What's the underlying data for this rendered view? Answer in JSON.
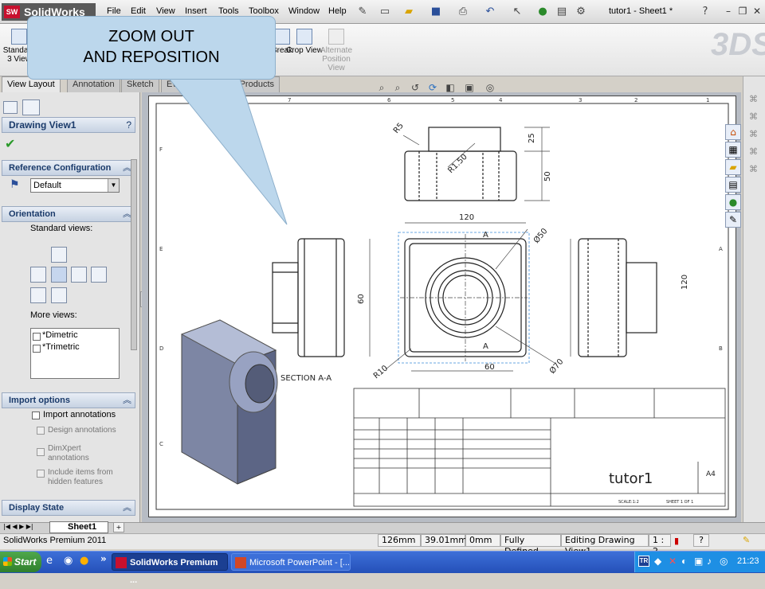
{
  "app": {
    "logo_text": "SolidWorks",
    "doc_title": "tutor1 - Sheet1 *"
  },
  "menu": [
    "File",
    "Edit",
    "View",
    "Insert",
    "Tools",
    "Toolbox",
    "Window",
    "Help"
  ],
  "command_bar": {
    "standard_views_label": "Standard 3 View",
    "break_label": "Break",
    "crop_view_label": "Crop View",
    "alternate_position_label": "Alternate Position View"
  },
  "tabs": [
    "View Layout",
    "Annotation",
    "Sketch",
    "Evaluate",
    "Office Products"
  ],
  "callout": {
    "line1": "ZOOM OUT",
    "line2": "AND REPOSITION"
  },
  "property_manager": {
    "title": "Drawing View1",
    "help": "?",
    "reference_configuration": {
      "title": "Reference Configuration",
      "value": "Default"
    },
    "orientation": {
      "title": "Orientation",
      "standard_views_label": "Standard views:",
      "more_views_label": "More views:",
      "more_views": [
        "*Dimetric",
        "*Trimetric"
      ]
    },
    "import_options": {
      "title": "Import options",
      "import_annotations": "Import annotations",
      "design_annotations": "Design annotations",
      "dimxpert_annotations": "DimXpert annotations",
      "hidden_features": "Include items from hidden features"
    },
    "display_state": {
      "title": "Display State"
    }
  },
  "drawing": {
    "section_label": "SECTION A-A",
    "dims": {
      "r5": "R5",
      "r1_50": "R1.50",
      "d25": "25",
      "d50": "50",
      "d120_top": "120",
      "d60_left": "60",
      "phi50": "Ø50",
      "d120_right": "120",
      "d60_bottom": "60",
      "r10": "R10",
      "phi70": "Ø70",
      "a_top": "A",
      "a_bottom": "A"
    },
    "border_numbers": [
      "8",
      "7",
      "6",
      "5",
      "4",
      "3",
      "2",
      "1"
    ],
    "border_letters": [
      "F",
      "E",
      "D",
      "C",
      "B",
      "A"
    ],
    "titleblock": {
      "title": "tutor1",
      "size": "A4",
      "scale": "SCALE:1:2",
      "sheet": "SHEET 1 OF 1"
    }
  },
  "sheet_tab": "Sheet1",
  "status": {
    "app": "SolidWorks Premium 2011",
    "x": "126mm",
    "y": "39.01mm",
    "z": "0mm",
    "state": "Fully Defined",
    "editing": "Editing Drawing View1",
    "scale": "1 : 2",
    "help": "?"
  },
  "taskbar": {
    "start": "Start",
    "chevron": "»",
    "task1": "SolidWorks Premium ...",
    "task2": "Microsoft PowerPoint - [...",
    "lang": "TR",
    "clock": "21:23"
  }
}
